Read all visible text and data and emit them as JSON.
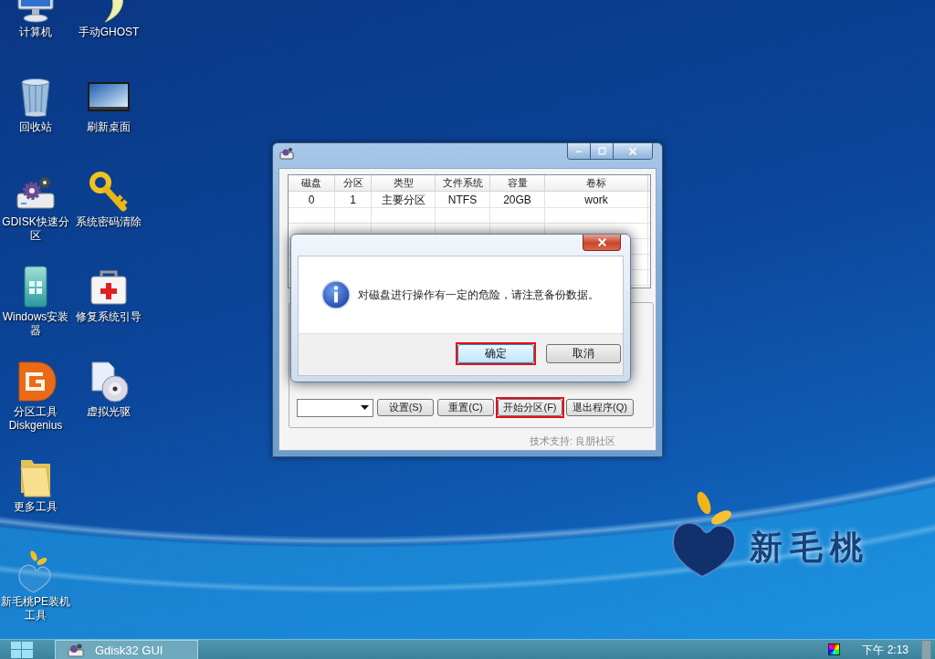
{
  "desktop_icons": [
    {
      "label": "计算机",
      "kind": "computer"
    },
    {
      "label": "回收站",
      "kind": "recycle_bin"
    },
    {
      "label": "GDISK快速分区",
      "kind": "gdisk"
    },
    {
      "label": "Windows安装器",
      "kind": "installer"
    },
    {
      "label": "分区工具Diskgenius",
      "kind": "diskgenius"
    },
    {
      "label": "更多工具",
      "kind": "folder"
    },
    {
      "label": "新毛桃PE装机工具",
      "kind": "peach"
    },
    {
      "label": "手动GHOST",
      "kind": "ghost"
    },
    {
      "label": "刷新桌面",
      "kind": "desktop"
    },
    {
      "label": "系统密码清除",
      "kind": "key"
    },
    {
      "label": "修复系统引导",
      "kind": "first_aid"
    },
    {
      "label": "虚拟光驱",
      "kind": "virtual_drive"
    }
  ],
  "window": {
    "table": {
      "columns": [
        "磁盘",
        "分区",
        "类型",
        "文件系统",
        "容量",
        "卷标"
      ],
      "rows": [
        [
          "0",
          "1",
          "主要分区",
          "NTFS",
          "20GB",
          "work"
        ]
      ]
    },
    "buttons": [
      {
        "label": "设置(S)",
        "highlighted": false
      },
      {
        "label": "重置(C)",
        "highlighted": false
      },
      {
        "label": "开始分区(F)",
        "highlighted": true
      },
      {
        "label": "退出程序(Q)",
        "highlighted": false
      }
    ],
    "footer": "技术支持: 良朋社区"
  },
  "dialog": {
    "message": "对磁盘进行操作有一定的危险，请注意备份数据。",
    "buttons": [
      {
        "label": "确定",
        "highlighted": true,
        "focused": true
      },
      {
        "label": "取消",
        "highlighted": false,
        "focused": false
      }
    ]
  },
  "logo": {
    "text": "新毛桃"
  },
  "taskbar": {
    "tasks": [
      {
        "label": "Gdisk32 GUI"
      }
    ],
    "clock": "下午 2:13"
  }
}
